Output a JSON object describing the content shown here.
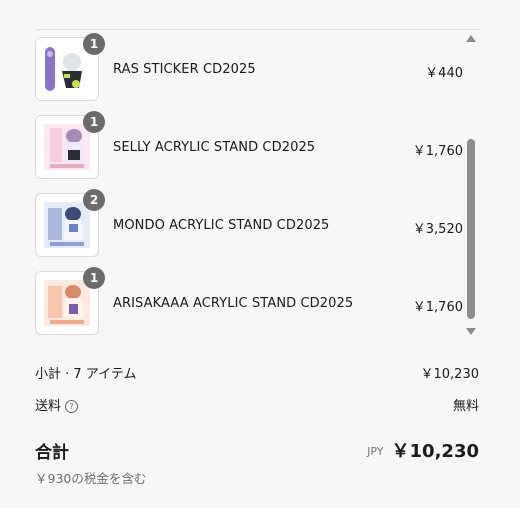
{
  "items": [
    {
      "name": "RAS STICKER CD2025",
      "price": "￥440",
      "qty": "1",
      "icon": "sticker-thumbnail",
      "bg": "#ffffff"
    },
    {
      "name": "SELLY ACRYLIC STAND CD2025",
      "price": "￥1,760",
      "qty": "1",
      "icon": "acrylic-stand-thumbnail",
      "bg": "#fbe8f0"
    },
    {
      "name": "MONDO ACRYLIC STAND CD2025",
      "price": "￥3,520",
      "qty": "2",
      "icon": "acrylic-stand-thumbnail",
      "bg": "#e6ecf7"
    },
    {
      "name": "ARISAKAAA ACRYLIC STAND CD2025",
      "price": "￥1,760",
      "qty": "1",
      "icon": "acrylic-stand-thumbnail",
      "bg": "#fde9df"
    }
  ],
  "summary": {
    "subtotal_label": "小計 · 7 アイテム",
    "subtotal_value": "￥10,230",
    "shipping_label": "送料",
    "shipping_help_icon": "question-circle-icon",
    "shipping_value": "無料",
    "total_label": "合計",
    "currency": "JPY",
    "total_value": "￥10,230",
    "tax_note": "￥930の税金を含む"
  }
}
